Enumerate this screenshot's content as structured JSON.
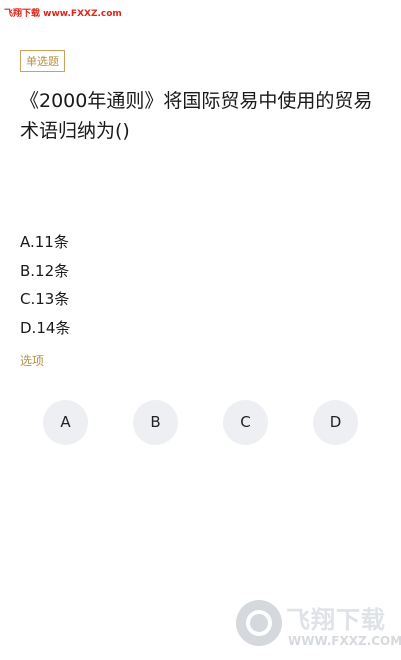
{
  "watermark_top": "飞翔下载 www.FXXZ.com",
  "question": {
    "type_badge": "单选题",
    "text": "《2000年通则》将国际贸易中使用的贸易术语归纳为()",
    "options": [
      "A.11条",
      "B.12条",
      "C.13条",
      "D.14条"
    ]
  },
  "answer_section": {
    "label": "选项",
    "choices": [
      "A",
      "B",
      "C",
      "D"
    ]
  },
  "watermark_bottom": {
    "name": "飞翔下载",
    "url": "WWW.FXXZ.COM"
  },
  "colors": {
    "accent_gold": "#b8904a",
    "choice_bg": "#eeeff2",
    "watermark_red": "#e0261b"
  }
}
